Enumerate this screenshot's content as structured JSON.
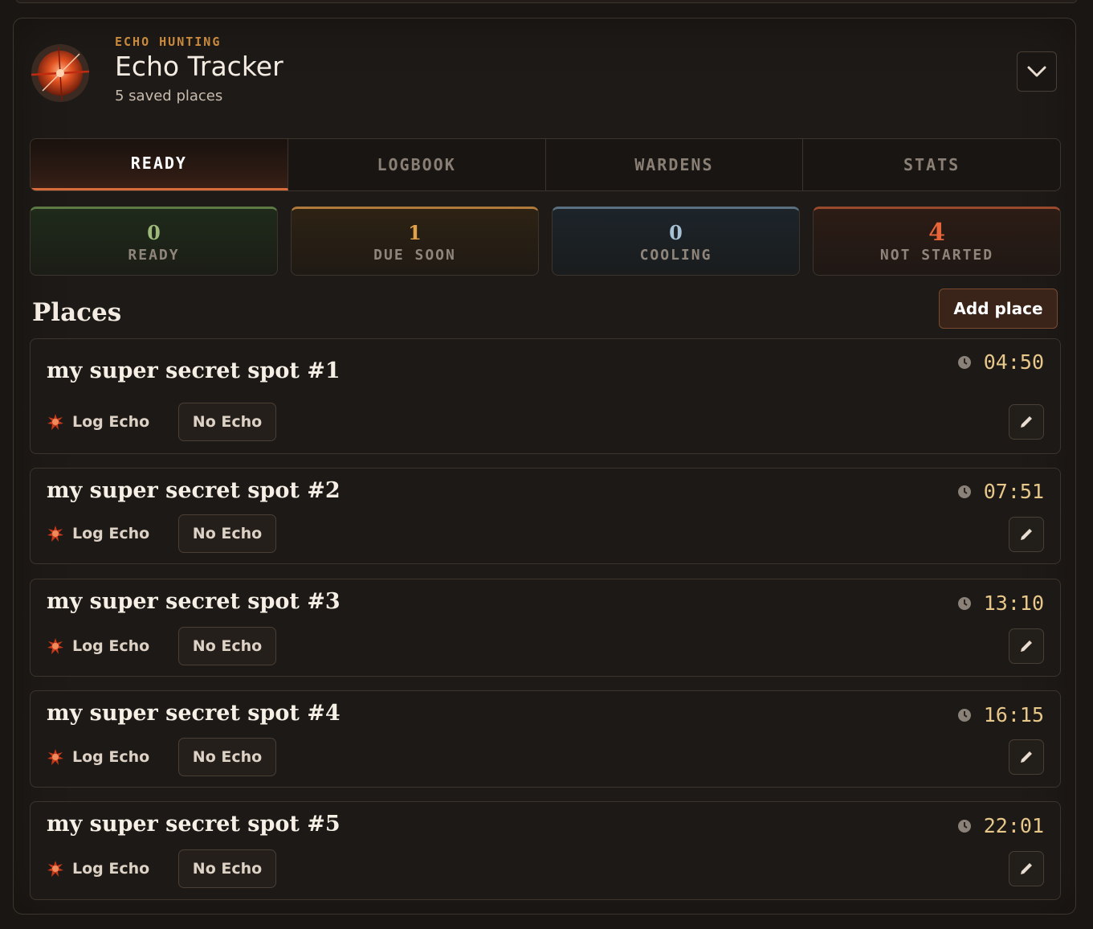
{
  "header": {
    "eyebrow": "ECHO HUNTING",
    "title": "Echo Tracker",
    "subtitle": "5 saved places"
  },
  "tabs": [
    {
      "label": "READY",
      "active": true
    },
    {
      "label": "LOGBOOK",
      "active": false
    },
    {
      "label": "WARDENS",
      "active": false
    },
    {
      "label": "STATS",
      "active": false
    }
  ],
  "stats": [
    {
      "value": "0",
      "label": "READY"
    },
    {
      "value": "1",
      "label": "DUE SOON"
    },
    {
      "value": "0",
      "label": "COOLING"
    },
    {
      "value": "4",
      "label": "NOT STARTED"
    }
  ],
  "places_section": {
    "title": "Places",
    "add_label": "Add place"
  },
  "places": [
    {
      "name": "my super secret spot #1",
      "timer": "04:50",
      "log_label": "Log Echo",
      "no_echo_label": "No Echo"
    },
    {
      "name": "my super secret spot #2",
      "timer": "07:51",
      "log_label": "Log Echo",
      "no_echo_label": "No Echo"
    },
    {
      "name": "my super secret spot #3",
      "timer": "13:10",
      "log_label": "Log Echo",
      "no_echo_label": "No Echo"
    },
    {
      "name": "my super secret spot #4",
      "timer": "16:15",
      "log_label": "Log Echo",
      "no_echo_label": "No Echo"
    },
    {
      "name": "my super secret spot #5",
      "timer": "22:01",
      "log_label": "Log Echo",
      "no_echo_label": "No Echo"
    }
  ],
  "icons": {
    "logo": "echo-compass-icon",
    "collapse": "chevron-down-icon",
    "timer": "clock-icon",
    "log": "echo-burst-icon",
    "edit": "pencil-icon"
  },
  "colors": {
    "accent": "#d96c3b",
    "ready": "#9fb97a",
    "due_soon": "#e2a24a",
    "cooling": "#a7c1d4",
    "not_started": "#e8653a"
  }
}
